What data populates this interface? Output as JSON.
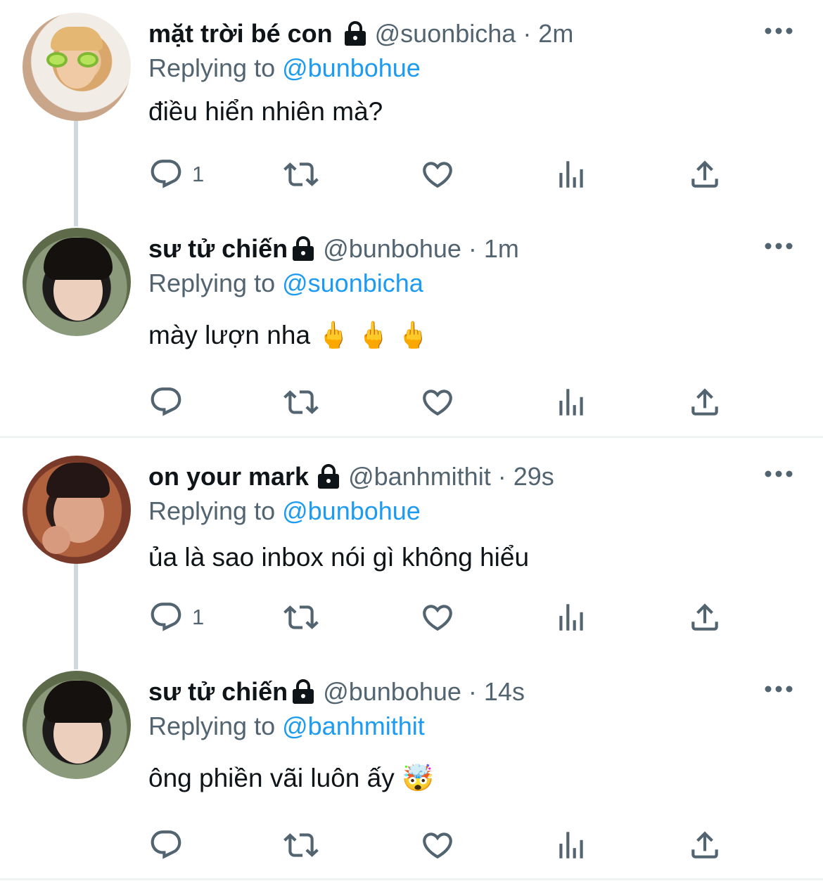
{
  "tweets": [
    {
      "name": "mặt trời bé con",
      "handle_time": "@suonbicha · 2m",
      "replying_prefix": "Replying to ",
      "replying_to": "@bunbohue",
      "text": "điều hiển nhiên mà?",
      "reply_count": "1"
    },
    {
      "name": "sư tử chiến",
      "handle_time": "@bunbohue · 1m",
      "replying_prefix": "Replying to ",
      "replying_to": "@suonbicha",
      "text": "mày lượn nha 🖕 🖕 🖕",
      "reply_count": ""
    },
    {
      "name": "on your mark",
      "handle_time": "@banhmithit · 29s",
      "replying_prefix": "Replying to ",
      "replying_to": "@bunbohue",
      "text": "ủa là sao inbox nói gì không hiểu",
      "reply_count": "1"
    },
    {
      "name": "sư tử chiến",
      "handle_time": "@bunbohue · 14s",
      "replying_prefix": "Replying to ",
      "replying_to": "@banhmithit",
      "text": "ông phiền vãi luôn ấy 🤯",
      "reply_count": ""
    }
  ],
  "icons": {
    "reply": "reply-icon",
    "retweet": "retweet-icon",
    "like": "heart-icon",
    "views": "analytics-icon",
    "share": "share-icon",
    "lock": "lock-icon",
    "more": "more-icon"
  },
  "colors": {
    "text": "#0f1419",
    "secondary": "#536471",
    "link": "#1d9bf0",
    "thread_line": "#cfd9de"
  }
}
